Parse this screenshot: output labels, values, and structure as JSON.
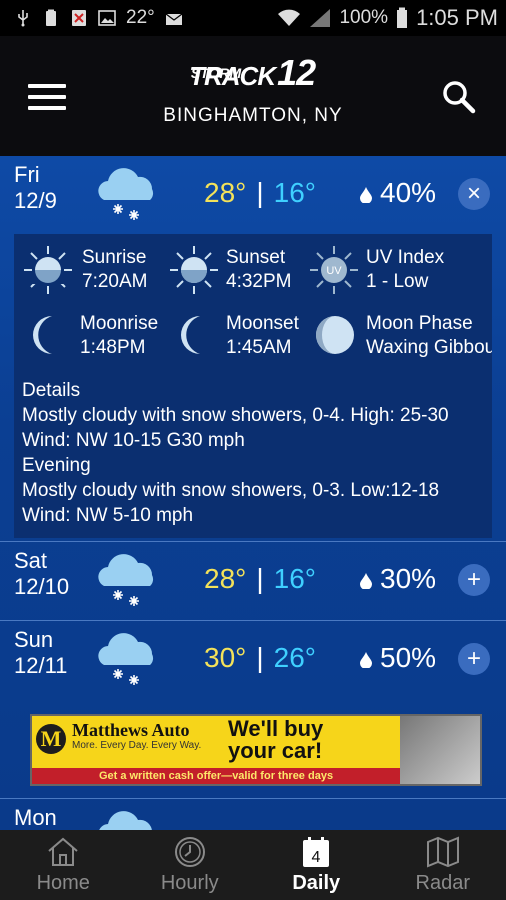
{
  "status_bar": {
    "left_items": [
      "usb-icon",
      "battery-100-icon",
      "x-icon",
      "image-icon",
      "temp",
      "mail-icon"
    ],
    "temperature": "22°",
    "battery": "100%",
    "time": "1:05 PM"
  },
  "header": {
    "brand_top": "STORM",
    "brand_bottom": "TRACK",
    "brand_number": "12",
    "location": "BINGHAMTON, NY"
  },
  "days": [
    {
      "name": "Fri",
      "date": "12/9",
      "high": "28°",
      "low": "16°",
      "precip": "40%",
      "toggle": "×",
      "icon": "snow-cloud-icon"
    },
    {
      "name": "Sat",
      "date": "12/10",
      "high": "28°",
      "low": "16°",
      "precip": "30%",
      "toggle": "+",
      "icon": "snow-cloud-icon"
    },
    {
      "name": "Sun",
      "date": "12/11",
      "high": "30°",
      "low": "26°",
      "precip": "50%",
      "toggle": "+",
      "icon": "snow-cloud-icon"
    },
    {
      "name": "Mon",
      "icon": "snow-cloud-icon"
    }
  ],
  "separator": "|",
  "astro": {
    "sunrise": {
      "label": "Sunrise",
      "value": "7:20AM"
    },
    "sunset": {
      "label": "Sunset",
      "value": "4:32PM"
    },
    "uv": {
      "label": "UV Index",
      "value": "1 - Low",
      "badge": "UV"
    },
    "moonrise": {
      "label": "Moonrise",
      "value": "1:48PM"
    },
    "moonset": {
      "label": "Moonset",
      "value": "1:45AM"
    },
    "moon_phase": {
      "label": "Moon Phase",
      "value": "Waxing Gibbous"
    }
  },
  "details": {
    "heading": "Details",
    "line1": "Mostly cloudy with snow showers, 0-4. High: 25-30",
    "line2": "Wind: NW 10-15 G30 mph",
    "evening_heading": "Evening",
    "line3": "Mostly cloudy with snow showers, 0-3. Low:12-18",
    "line4": "Wind: NW 5-10 mph"
  },
  "ad": {
    "logo_letter": "M",
    "name": "Matthews Auto",
    "tagline": "More. Every Day. Every Way.",
    "headline1": "We'll buy",
    "headline2": "your car!",
    "footer": "Get a written cash offer—valid for three days"
  },
  "nav": [
    {
      "label": "Home",
      "icon": "home-icon"
    },
    {
      "label": "Hourly",
      "icon": "clock-icon"
    },
    {
      "label": "Daily",
      "icon": "calendar-icon",
      "badge": "4"
    },
    {
      "label": "Radar",
      "icon": "map-icon"
    }
  ],
  "colors": {
    "high_temp": "#f3e25a",
    "low_temp": "#3fd0ff",
    "header_bg": "#0c0c0f",
    "content_bg": "#0e4aa6"
  }
}
